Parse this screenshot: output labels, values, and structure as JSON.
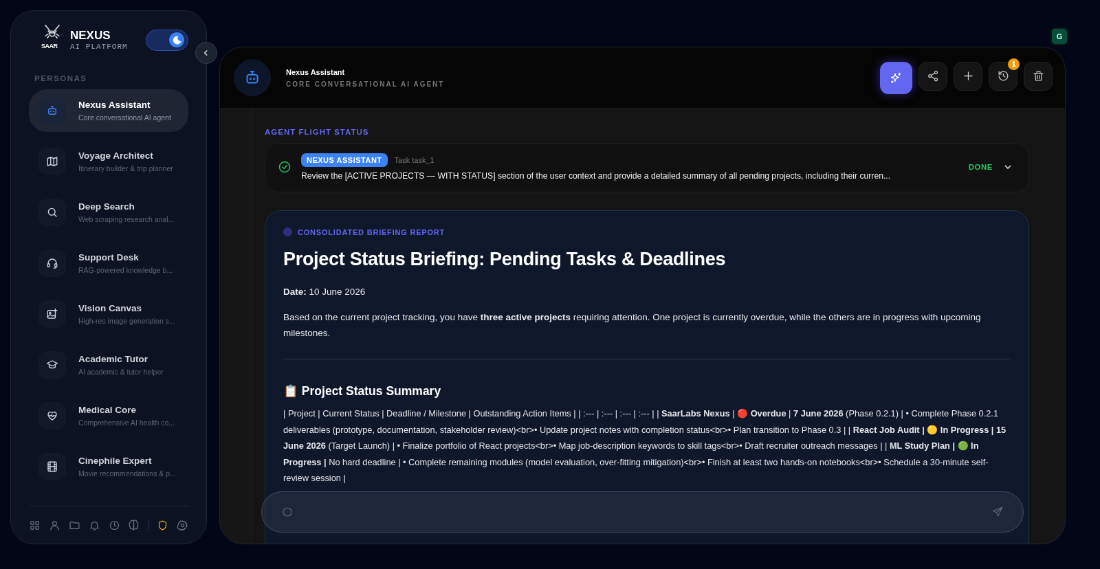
{
  "brand": {
    "name": "NEXUS",
    "tagline": "AI PLATFORM",
    "logo_text": "SAAR"
  },
  "dark_mode": true,
  "sidebar": {
    "section": "PERSONAS",
    "items": [
      {
        "name": "Nexus Assistant",
        "description": "Core conversational AI agent",
        "kind": "robot",
        "selected": true
      },
      {
        "name": "Voyage Architect",
        "description": "Itinerary builder & trip planner",
        "kind": "map",
        "selected": false
      },
      {
        "name": "Deep Search",
        "description": "Web scraping research anal...",
        "kind": "search",
        "selected": false
      },
      {
        "name": "Support Desk",
        "description": "RAG-powered knowledge b...",
        "kind": "headset",
        "selected": false
      },
      {
        "name": "Vision Canvas",
        "description": "High-res image generation s...",
        "kind": "image",
        "selected": false
      },
      {
        "name": "Academic Tutor",
        "description": "AI academic & tutor helper",
        "kind": "cap",
        "selected": false
      },
      {
        "name": "Medical Core",
        "description": "Comprehensive AI health co...",
        "kind": "heart",
        "selected": false
      },
      {
        "name": "Cinephile Expert",
        "description": "Movie recommendations & p...",
        "kind": "film",
        "selected": false
      }
    ],
    "nav": [
      {
        "kind": "grid"
      },
      {
        "kind": "user"
      },
      {
        "kind": "folder"
      },
      {
        "kind": "bell"
      },
      {
        "kind": "clock"
      },
      {
        "kind": "brain"
      },
      {
        "kind": "shield"
      },
      {
        "kind": "gear"
      }
    ]
  },
  "user_avatar": "G",
  "header": {
    "title": "Nexus Assistant",
    "subtitle": "CORE CONVERSATIONAL AI AGENT",
    "actions": [
      {
        "kind": "sparkle",
        "active": true
      },
      {
        "kind": "share",
        "active": false
      },
      {
        "kind": "plus",
        "active": false
      },
      {
        "kind": "history",
        "active": false,
        "badge": "1"
      },
      {
        "kind": "trash",
        "active": false
      }
    ]
  },
  "flight_status": {
    "label": "AGENT FLIGHT STATUS",
    "task": {
      "agent": "NEXUS ASSISTANT",
      "task_id": "Task task_1",
      "description": "Review the [ACTIVE PROJECTS — WITH STATUS] section of the user context and provide a detailed summary of all pending projects, including their curren...",
      "status": "DONE",
      "done": true,
      "expanded": false
    }
  },
  "report": {
    "label": "CONSOLIDATED BRIEFING REPORT",
    "title": "Project Status Briefing: Pending Tasks & Deadlines",
    "paragraphs": [
      "**Date:** 10 June 2026",
      "Based on the current project tracking, you have **three active projects** requiring attention. One project is currently overdue, while the others are in progress with upcoming milestones."
    ],
    "section_heading": "📋 Project Status Summary",
    "table_text": "| Project | Current Status | Deadline / Milestone | Outstanding Action Items | | :--- | :--- | :--- | :--- | | **SaarLabs Nexus** | 🔴 **Overdue** | **7 June 2026** (Phase 0.2.1) | • Complete Phase 0.2.1 deliverables (prototype, documentation, stakeholder review)<br>• Update project notes with completion status<br>• Plan transition to Phase 0.3 | | **React Job Audit | 🟡 In Progress | 15 June 2026** (Target Launch) | • Finalize portfolio of React projects<br>• Map job-description keywords to skill tags<br>• Draft recruiter outreach messages | | **ML Study Plan | 🟢 In Progress |** No hard deadline | • Complete remaining modules (model evaluation, over-fitting mitigation)<br>• Finish at least two hands-on notebooks<br>• Schedule a 30-minute self-review session |"
  }
}
